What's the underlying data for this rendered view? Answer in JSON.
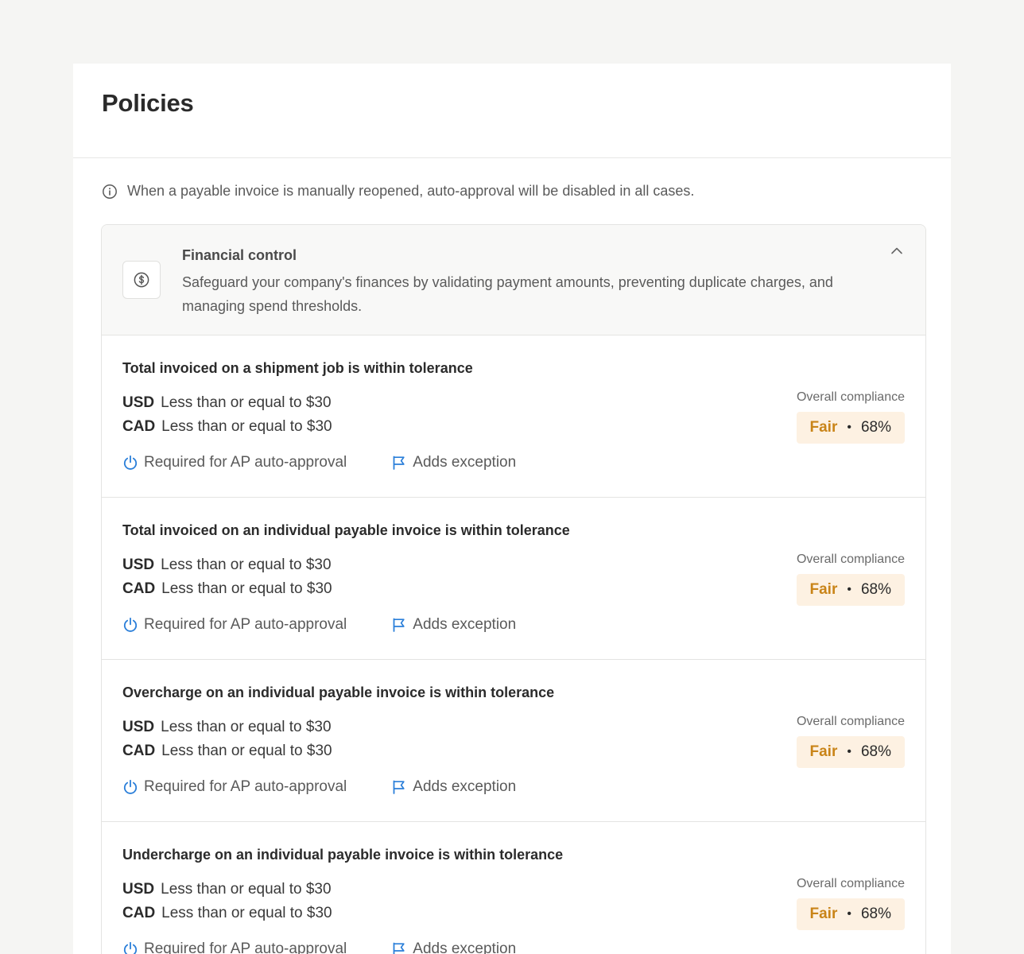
{
  "page": {
    "title": "Policies"
  },
  "notice": {
    "text": "When a payable invoice is manually reopened, auto-approval will be disabled in all cases."
  },
  "section": {
    "title": "Financial control",
    "description": "Safeguard your company's finances by validating payment amounts, preventing duplicate charges, and managing spend thresholds.",
    "icon": "dollar-circle-icon",
    "expanded": true
  },
  "colors": {
    "accent_blue": "#2b7fd9",
    "fair_text": "#c98418",
    "fair_bg": "#fdf1e2"
  },
  "rules": [
    {
      "title": "Total invoiced on a shipment job is within tolerance",
      "limits": [
        {
          "currency": "USD",
          "text": "Less than or equal to $30"
        },
        {
          "currency": "CAD",
          "text": "Less than or equal to $30"
        }
      ],
      "required_label": "Required for AP auto-approval",
      "exception_label": "Adds exception",
      "compliance_label": "Overall compliance",
      "compliance_level": "Fair",
      "compliance_value": "68%"
    },
    {
      "title": "Total invoiced on an individual payable invoice is within tolerance",
      "limits": [
        {
          "currency": "USD",
          "text": "Less than or equal to $30"
        },
        {
          "currency": "CAD",
          "text": "Less than or equal to $30"
        }
      ],
      "required_label": "Required for AP auto-approval",
      "exception_label": "Adds exception",
      "compliance_label": "Overall compliance",
      "compliance_level": "Fair",
      "compliance_value": "68%"
    },
    {
      "title": "Overcharge on an individual payable invoice is within tolerance",
      "limits": [
        {
          "currency": "USD",
          "text": "Less than or equal to $30"
        },
        {
          "currency": "CAD",
          "text": "Less than or equal to $30"
        }
      ],
      "required_label": "Required for AP auto-approval",
      "exception_label": "Adds exception",
      "compliance_label": "Overall compliance",
      "compliance_level": "Fair",
      "compliance_value": "68%"
    },
    {
      "title": "Undercharge on an individual payable invoice is within tolerance",
      "limits": [
        {
          "currency": "USD",
          "text": "Less than or equal to $30"
        },
        {
          "currency": "CAD",
          "text": "Less than or equal to $30"
        }
      ],
      "required_label": "Required for AP auto-approval",
      "exception_label": "Adds exception",
      "compliance_label": "Overall compliance",
      "compliance_level": "Fair",
      "compliance_value": "68%"
    }
  ]
}
